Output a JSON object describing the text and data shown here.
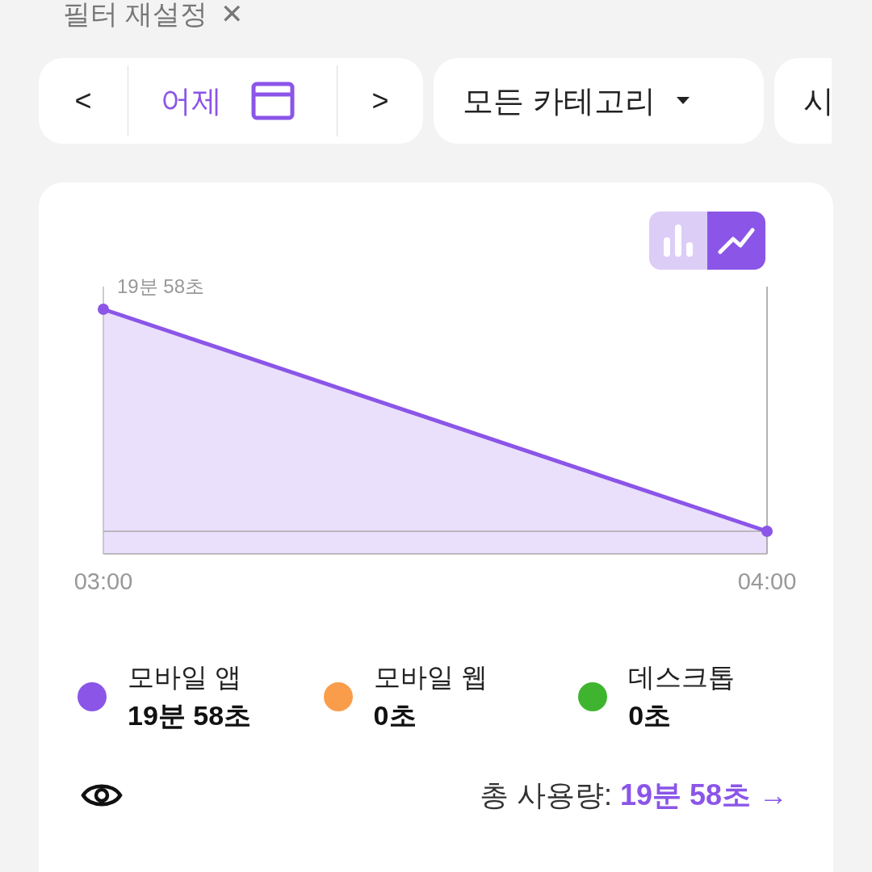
{
  "filter_reset": {
    "label": "필터 재설정",
    "close": "✕"
  },
  "filters": {
    "prev": "<",
    "date": "어제",
    "next": ">",
    "category": "모든 카테고리",
    "third": "시"
  },
  "chart_toggle": [
    {
      "kind": "bar",
      "selected": false
    },
    {
      "kind": "line",
      "selected": true
    }
  ],
  "chart": {
    "peak_label": "19분 58초",
    "x_labels": [
      "03:00",
      "04:00"
    ]
  },
  "legend": [
    {
      "label": "모바일 앱",
      "value": "19분 58초",
      "color": "#8b55e8"
    },
    {
      "label": "모바일 웹",
      "value": "0초",
      "color": "#fa9d4a"
    },
    {
      "label": "데스크톱",
      "value": "0초",
      "color": "#3fb52f"
    }
  ],
  "total": {
    "label": "총 사용량:",
    "value": "19분 58초",
    "arrow": "→"
  }
}
